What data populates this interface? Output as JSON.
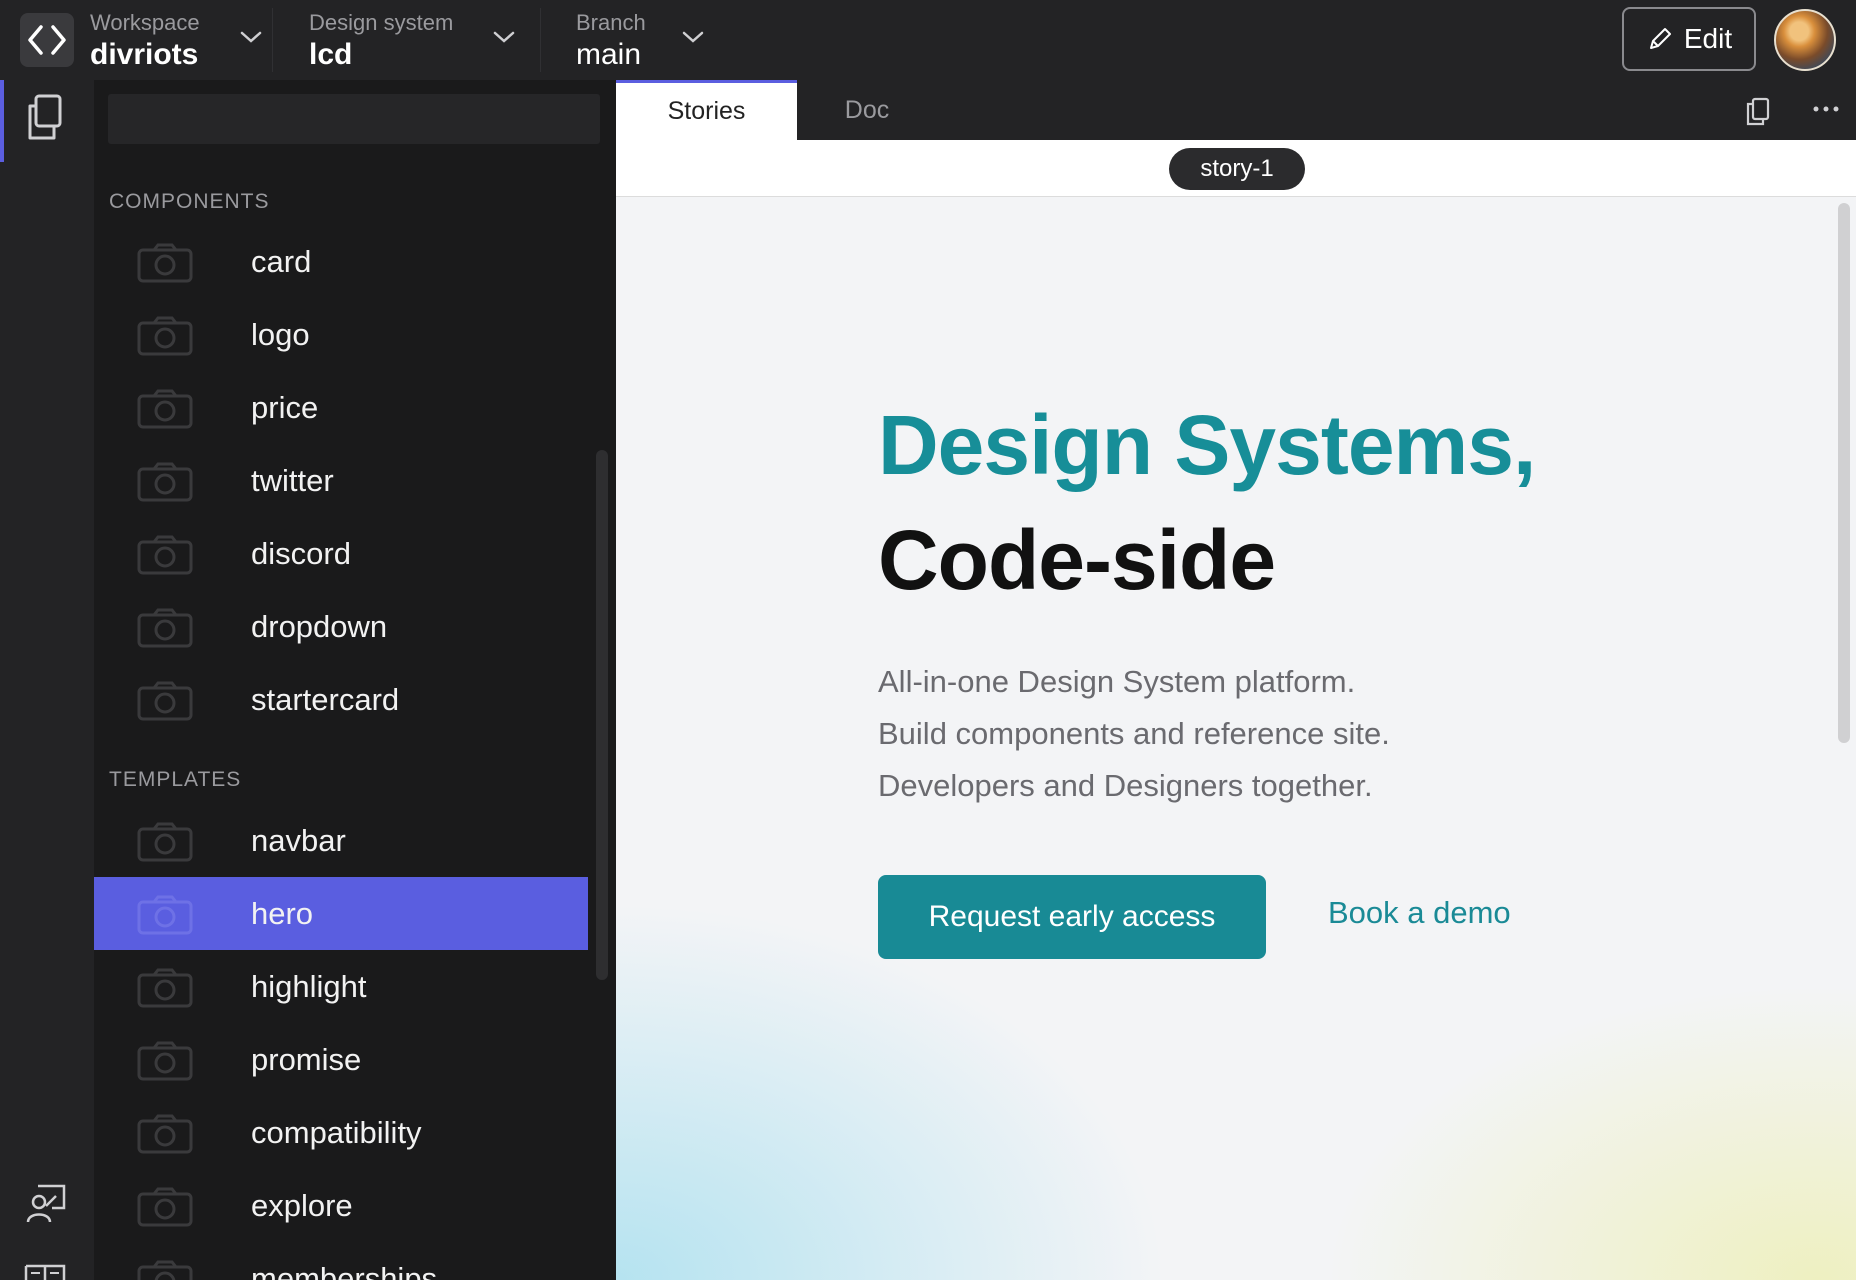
{
  "topbar": {
    "workspace": {
      "caption": "Workspace",
      "value": "divriots"
    },
    "design_system": {
      "caption": "Design system",
      "value": "lcd"
    },
    "branch": {
      "caption": "Branch",
      "value": "main"
    },
    "edit_label": "Edit"
  },
  "sidebar": {
    "search_value": "",
    "sections": [
      {
        "title": "COMPONENTS",
        "items": [
          {
            "label": "card"
          },
          {
            "label": "logo"
          },
          {
            "label": "price"
          },
          {
            "label": "twitter"
          },
          {
            "label": "discord"
          },
          {
            "label": "dropdown"
          },
          {
            "label": "startercard"
          }
        ]
      },
      {
        "title": "TEMPLATES",
        "items": [
          {
            "label": "navbar"
          },
          {
            "label": "hero",
            "selected": true
          },
          {
            "label": "highlight"
          },
          {
            "label": "promise"
          },
          {
            "label": "compatibility"
          },
          {
            "label": "explore"
          },
          {
            "label": "memberships"
          }
        ]
      }
    ]
  },
  "tabs": [
    {
      "label": "Stories",
      "active": true
    },
    {
      "label": "Doc",
      "active": false
    }
  ],
  "story_pill": "story-1",
  "preview": {
    "title_line1": "Design Systems,",
    "title_line2": "Code-side",
    "subtitle_lines": [
      "All-in-one Design System platform.",
      "Build components and reference site.",
      "Developers and Designers together."
    ],
    "primary_cta": "Request early access",
    "secondary_link": "Book a demo"
  },
  "colors": {
    "accent_selection": "#5a5ee0",
    "brand_teal": "#178e98",
    "cta_teal": "#188a95"
  },
  "icons": {
    "app_logo": "code-brackets-icon",
    "rail_top": "copy-pages-icon",
    "rail_bottom_1": "presenter-icon",
    "rail_bottom_2": "book-icon",
    "edit": "pencil-icon",
    "item_thumb": "camera-icon",
    "copy": "copy-icon",
    "more": "more-horizontal-icon"
  }
}
